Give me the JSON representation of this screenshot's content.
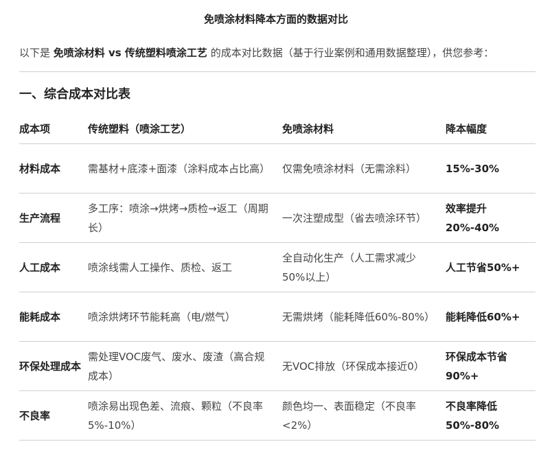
{
  "title": "免喷涂材料降本方面的数据对比",
  "intro": {
    "prefix": "以下是 ",
    "bold": "免喷涂材料 vs 传统塑料喷涂工艺",
    "suffix": " 的成本对比数据（基于行业案例和通用数据整理），供您参考："
  },
  "section": {
    "heading": "一、综合成本对比表"
  },
  "table": {
    "headers": [
      "成本项",
      "传统塑料（喷涂工艺）",
      "免喷涂材料",
      "降本幅度"
    ],
    "rows": [
      {
        "item": "材料成本",
        "traditional": "需基材+底漆+面漆（涂料成本占比高）",
        "spray_free": "仅需免喷涂材料（无需涂料）",
        "reduction": "15%-30%"
      },
      {
        "item": "生产流程",
        "traditional": "多工序：喷涂→烘烤→质检→返工（周期长）",
        "spray_free": "一次注塑成型（省去喷涂环节）",
        "reduction": "效率提升20%-40%"
      },
      {
        "item": "人工成本",
        "traditional": "喷涂线需人工操作、质检、返工",
        "spray_free": "全自动化生产（人工需求减少50%以上）",
        "reduction": "人工节省50%+"
      },
      {
        "item": "能耗成本",
        "traditional": "喷涂烘烤环节能耗高（电/燃气）",
        "spray_free": "无需烘烤（能耗降低60%-80%）",
        "reduction": "能耗降低60%+"
      },
      {
        "item": "环保处理成本",
        "traditional": "需处理VOC废气、废水、废渣（高合规成本）",
        "spray_free": "无VOC排放（环保成本接近0）",
        "reduction": "环保成本节省90%+"
      },
      {
        "item": "不良率",
        "traditional": "喷涂易出现色差、流痕、颗粒（不良率5%-10%）",
        "spray_free": "颜色均一、表面稳定（不良率<2%）",
        "reduction": "不良率降低50%-80%"
      }
    ]
  }
}
